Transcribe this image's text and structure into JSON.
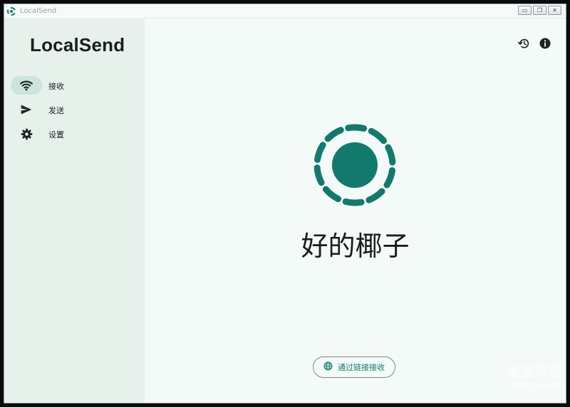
{
  "window": {
    "title": "LocalSend"
  },
  "sidebar": {
    "brand": "LocalSend",
    "items": [
      {
        "label": "接收",
        "icon": "wifi-icon",
        "active": true
      },
      {
        "label": "发送",
        "icon": "send-icon",
        "active": false
      },
      {
        "label": "设置",
        "icon": "gear-icon",
        "active": false
      }
    ]
  },
  "main": {
    "device_name": "好的椰子",
    "link_receive_label": "通过链接接收",
    "top_icons": [
      "history-icon",
      "info-icon"
    ]
  },
  "watermark": {
    "line1": "爱思考吧",
    "line2": "isres.com"
  },
  "colors": {
    "accent": "#117a6d",
    "sidebar_bg": "#e6f1ec",
    "main_bg": "#f4faf7",
    "active_pill": "#c9e5dc"
  }
}
